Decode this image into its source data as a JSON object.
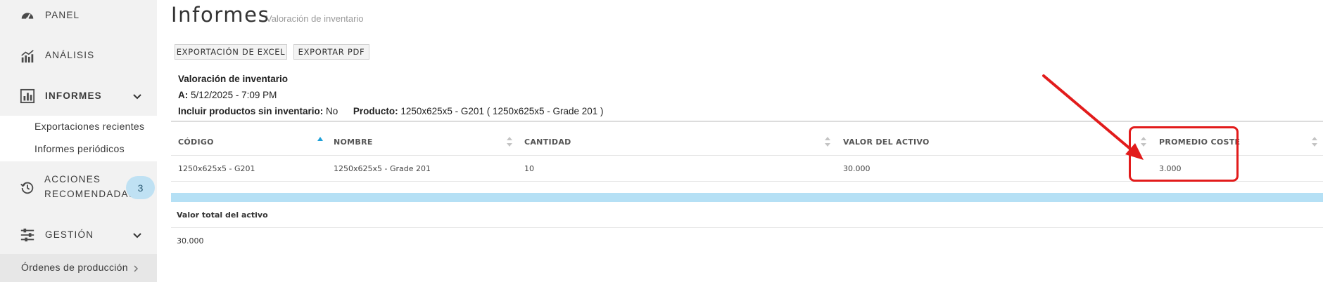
{
  "sidebar": {
    "items": [
      {
        "label": "PANEL",
        "icon": "dashboard-gauge-icon"
      },
      {
        "label": "ANÁLISIS",
        "icon": "bar-line-chart-icon"
      },
      {
        "label": "INFORMES",
        "icon": "report-chart-icon"
      },
      {
        "label_line1": "ACCIONES",
        "label_line2": "RECOMENDADAS",
        "icon": "history-clock-icon",
        "badge": "3"
      },
      {
        "label": "GESTIÓN",
        "icon": "sliders-icon"
      }
    ],
    "informes_submenu": [
      "Exportaciones recientes",
      "Informes periódicos"
    ],
    "production_orders": "Órdenes de producción"
  },
  "header": {
    "title": "Informes",
    "subtitle": "Valoración de inventario"
  },
  "toolbar": {
    "excel_label": "EXPORTACIÓN DE EXCEL",
    "pdf_label": "EXPORTAR PDF"
  },
  "report": {
    "name": "Valoración de inventario",
    "date_label": "A:",
    "date_value": "5/12/2025 - 7:09 PM",
    "include_label": "Incluir productos sin inventario:",
    "include_value": "No",
    "product_label": "Producto:",
    "product_value": "1250x625x5 - G201 ( 1250x625x5 - Grade 201 )"
  },
  "table": {
    "columns": [
      "CÓDIGO",
      "NOMBRE",
      "CANTIDAD",
      "VALOR DEL ACTIVO",
      "PROMEDIO COSTE"
    ],
    "rows": [
      [
        "1250x625x5 - G201",
        "1250x625x5 - Grade 201",
        "10",
        "30.000",
        "3.000"
      ]
    ],
    "total_label": "Valor total del activo",
    "total_value": "30.000"
  },
  "colors": {
    "sidebar_bg": "#f2f2f2",
    "accent_blue": "#b5e0f5",
    "badge_bg": "#bfe1f3",
    "annotation_red": "#e21b1b"
  }
}
